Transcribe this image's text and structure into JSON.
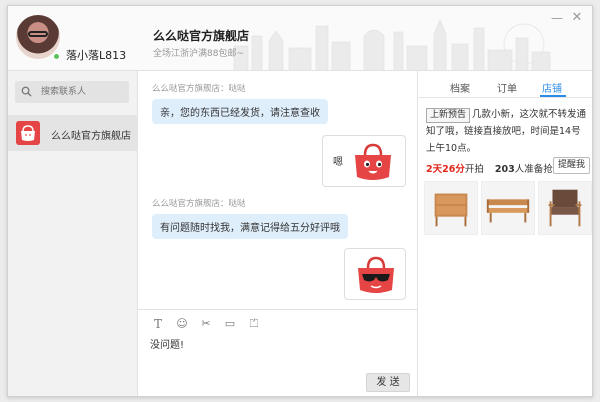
{
  "header": {
    "username": "落小落L813",
    "shop_title": "么么哒官方旗舰店",
    "shop_subtitle": "全场江浙沪满88包邮~",
    "minimize_label": "—",
    "close_label": "✕"
  },
  "sidebar": {
    "search_placeholder": "搜索联系人",
    "contacts": [
      {
        "name": "么么哒官方旗舰店"
      }
    ]
  },
  "chat": {
    "messages": [
      {
        "meta": "么么哒官方旗舰店：哒哒",
        "text": "亲，您的东西已经发货，请注意查收",
        "direction": "in"
      },
      {
        "text": "嗯",
        "sticker": "red-bag-smile-icon",
        "direction": "out"
      },
      {
        "meta": "么么哒官方旗舰店：哒哒",
        "text": "有问题随时找我，满意记得给五分好评哦",
        "direction": "in"
      },
      {
        "sticker": "red-bag-sunglasses-icon",
        "direction": "out"
      }
    ]
  },
  "input": {
    "tools": [
      "text-format-icon",
      "emoji-icon",
      "scissors-icon",
      "screen-capture-icon",
      "history-icon"
    ],
    "tool_glyphs": [
      "T",
      "☺",
      "✂",
      "▭",
      "⏍"
    ],
    "text": "没问题!",
    "send_label": "发 送"
  },
  "right_panel": {
    "tabs": [
      {
        "label": "档案",
        "active": false
      },
      {
        "label": "订单",
        "active": false
      },
      {
        "label": "店铺",
        "active": true
      }
    ],
    "promo_tag": "上新预告",
    "promo_text": "几款小新，这次就不转发通知了哦，链接直接放吧，时间是14号上午10点。",
    "countdown": {
      "days": "2天",
      "hours": "26分",
      "suffix": "开拍",
      "count": "203",
      "count_suffix": "人准备抢"
    },
    "remind_label": "提醒我",
    "products": [
      {
        "name": "wooden-cabinet"
      },
      {
        "name": "wooden-bench"
      },
      {
        "name": "brown-armchair"
      }
    ]
  },
  "colors": {
    "accent": "#2b8ce8",
    "bubble_in": "#dfeefb",
    "brand_red": "#e64545",
    "countdown_red": "#e1251b",
    "online": "#5cc15c"
  }
}
